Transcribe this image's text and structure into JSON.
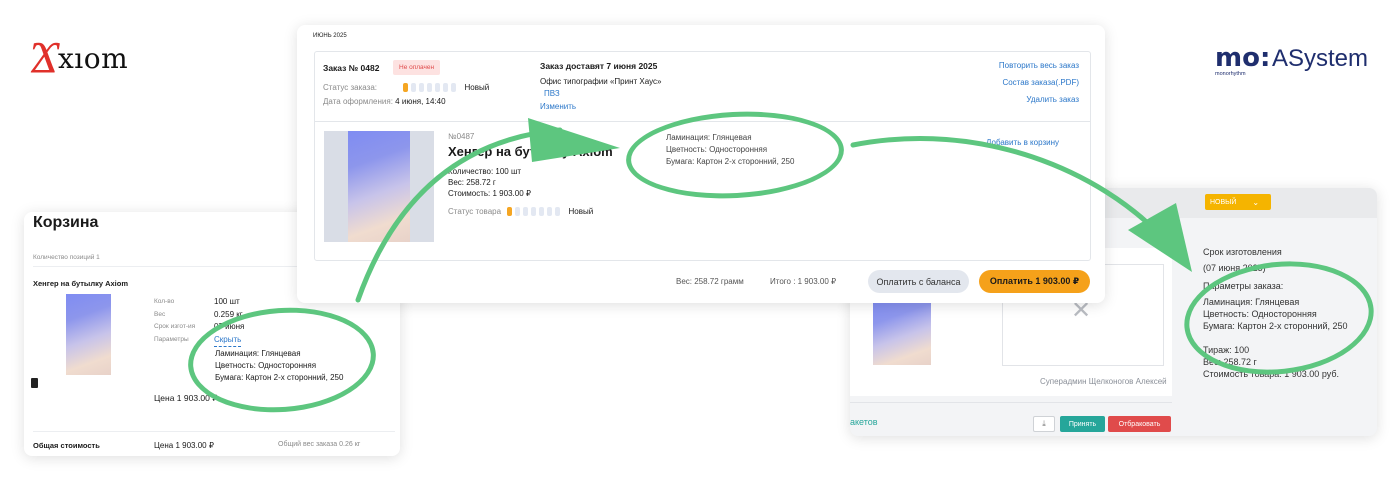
{
  "logos": {
    "axiom_x": "Ϫ",
    "axiom_word": "xıom",
    "mo_main": "mo:",
    "mo_sub": "monorhythm",
    "mo_name": "ASystem"
  },
  "cart": {
    "title": "Корзина",
    "count": "Количество позиций 1",
    "product": "Хенгер на бутылку Axiom",
    "rows": [
      {
        "label": "Кол-во",
        "value": "100 шт"
      },
      {
        "label": "Вес",
        "value": "0.259 кг"
      },
      {
        "label": "Срок изгот-ия",
        "value": "07 июня"
      },
      {
        "label": "Параметры",
        "value": "Скрыть"
      }
    ],
    "params": [
      "Ламинация: Глянцевая",
      "Цветность: Односторонняя",
      "Бумага: Картон 2-х сторонний, 250"
    ],
    "price": "Цена 1 903.00 ₽",
    "total_label": "Общая стоимость",
    "total_price": "Цена 1 903.00 ₽",
    "total_weight": "Общий вес заказа 0.26 кг",
    "trash_icon": "trash-icon"
  },
  "order": {
    "month": "ИЮНЬ 2025",
    "number": "Заказ № 0482",
    "badge": "Не оплачен",
    "status_label": "Статус заказа:",
    "status_value": "Новый",
    "date_label": "Дата оформления:",
    "date_value": "4 июня, 14:40",
    "delivery_title": "Заказ доставят 7 июня 2025",
    "delivery_address": "Офис типографии «Принт Хаус»",
    "delivery_type": "ПВЗ",
    "change": "Изменить",
    "actions": [
      "Повторить весь заказ",
      "Состав заказа(.PDF)",
      "Удалить заказ"
    ],
    "item": {
      "sku": "№0487",
      "name": "Хенгер на бутылку Axiom",
      "qty": "Количество: 100 шт",
      "weight": "Вес: 258.72 г",
      "cost": "Стоимость: 1 903.00 ₽",
      "status_label": "Статус товара",
      "status_value": "Новый",
      "params": [
        "Ламинация: Глянцевая",
        "Цветность: Односторонняя",
        "Бумага: Картон 2-х сторонний, 250"
      ],
      "add_to_cart": "Добавить в корзину"
    },
    "footer_weight": "Вес: 258.72 грамм",
    "footer_total": "Итого : 1 903.00 ₽",
    "pay_balance": "Оплатить с баланса",
    "pay": "Оплатить 1 903.00 ₽"
  },
  "admin": {
    "status_select": "НОВЫЙ",
    "deadline_title": "Срок изготовления",
    "deadline_value": "(07 июня 2025)",
    "params_title": "Параметры заказа:",
    "params": [
      "Ламинация: Глянцевая",
      "Цветность: Односторонняя",
      "Бумага: Картон 2-х сторонний, 250"
    ],
    "run": "Тираж: 100",
    "weight": "Вес: 258.72 г",
    "cost": "Стоимость товара: 1 903.00 руб.",
    "user": "Суперадмин Щелконогов Алексей",
    "layouts_link": "акетов",
    "accept": "Принять",
    "reject": "Отбраковать"
  },
  "colors": {
    "accent_orange": "#f5a623",
    "accent_green": "#5dc67f",
    "link_blue": "#2b77c9",
    "teal": "#26a69a",
    "red": "#e04b4b"
  }
}
